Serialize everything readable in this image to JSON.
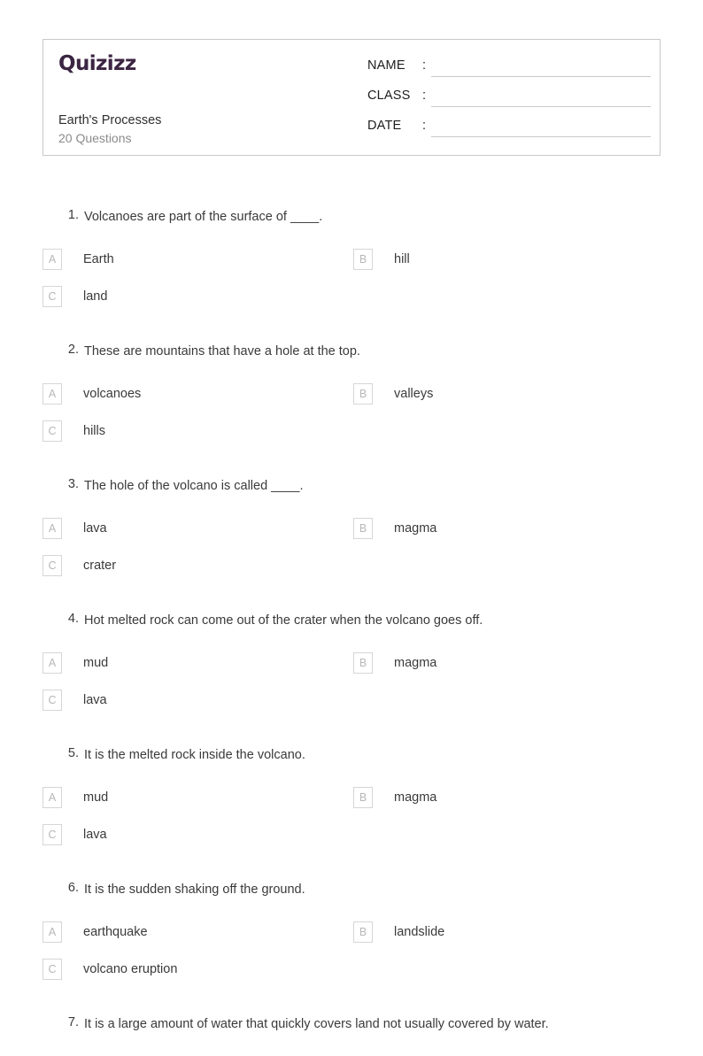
{
  "header": {
    "logo_text": "Quizizz",
    "quiz_title": "Earth's Processes",
    "question_count_label": "20 Questions",
    "fields": [
      {
        "label": "NAME",
        "colon": ":",
        "value": ""
      },
      {
        "label": "CLASS",
        "colon": ":",
        "value": ""
      },
      {
        "label": "DATE",
        "colon": ":",
        "value": ""
      }
    ]
  },
  "colors": {
    "brand_purple": "#3b2542",
    "border_gray": "#c9c9c9",
    "option_box_border": "#d6d6d6",
    "option_letter": "#b7b7b7",
    "text_dark": "#3a3a3a",
    "text_muted": "#8b8b8b"
  },
  "questions": [
    {
      "number": "1.",
      "text": "Volcanoes are part of the surface of ____.",
      "options": [
        {
          "letter": "A",
          "text": "Earth"
        },
        {
          "letter": "B",
          "text": "hill"
        },
        {
          "letter": "C",
          "text": "land"
        }
      ]
    },
    {
      "number": "2.",
      "text": "These are mountains that have a hole at the top.",
      "options": [
        {
          "letter": "A",
          "text": "volcanoes"
        },
        {
          "letter": "B",
          "text": "valleys"
        },
        {
          "letter": "C",
          "text": "hills"
        }
      ]
    },
    {
      "number": "3.",
      "text": "The hole of the volcano is called ____.",
      "options": [
        {
          "letter": "A",
          "text": "lava"
        },
        {
          "letter": "B",
          "text": "magma"
        },
        {
          "letter": "C",
          "text": "crater"
        }
      ]
    },
    {
      "number": "4.",
      "text": "Hot melted rock can come out of the crater when the volcano goes off.",
      "options": [
        {
          "letter": "A",
          "text": "mud"
        },
        {
          "letter": "B",
          "text": "magma"
        },
        {
          "letter": "C",
          "text": "lava"
        }
      ]
    },
    {
      "number": "5.",
      "text": "It is the melted rock inside the volcano.",
      "options": [
        {
          "letter": "A",
          "text": "mud"
        },
        {
          "letter": "B",
          "text": "magma"
        },
        {
          "letter": "C",
          "text": "lava"
        }
      ]
    },
    {
      "number": "6.",
      "text": "It is the sudden shaking off the ground.",
      "options": [
        {
          "letter": "A",
          "text": "earthquake"
        },
        {
          "letter": "B",
          "text": "landslide"
        },
        {
          "letter": "C",
          "text": "volcano eruption"
        }
      ]
    },
    {
      "number": "7.",
      "text": "It is a large amount of water that quickly covers land not usually covered by water.",
      "options": []
    }
  ]
}
